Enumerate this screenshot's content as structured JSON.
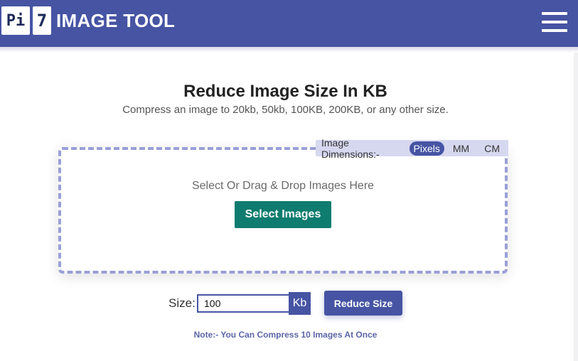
{
  "header": {
    "logo_part1": "Pi",
    "logo_part2": "7",
    "brand": "IMAGE TOOL",
    "menu_icon": "hamburger-menu-icon",
    "bg_color": "#4654a3"
  },
  "main": {
    "title": "Reduce Image Size In KB",
    "subtitle": "Compress an image to 20kb, 50kb, 100KB, 200KB, or any other size."
  },
  "dimensions": {
    "label": "Image Dimensions:-",
    "options": [
      "Pixels",
      "MM",
      "CM"
    ],
    "selected": "Pixels"
  },
  "upload": {
    "prompt": "Select Or Drag & Drop Images Here",
    "select_button": "Select Images",
    "button_color": "#0e7c6f"
  },
  "size": {
    "label": "Size:",
    "value": "100",
    "unit": "Kb",
    "reduce_button": "Reduce Size"
  },
  "note": "Note:- You Can Compress 10 Images At Once"
}
